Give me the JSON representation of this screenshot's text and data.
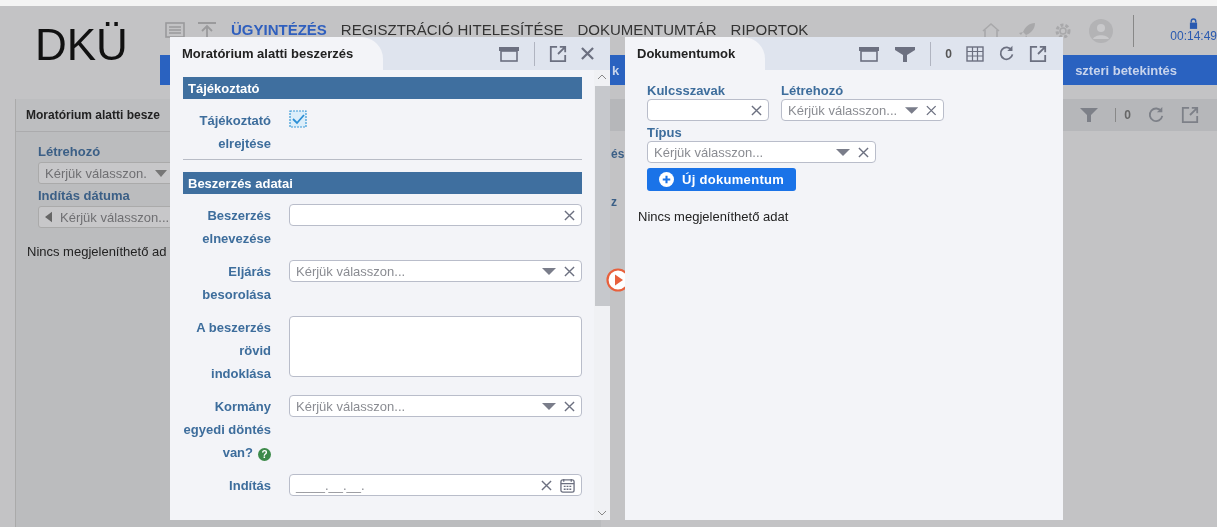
{
  "header": {
    "logo": "DKÜ",
    "nav": [
      {
        "label": "ÜGYINTÉZÉS",
        "selected": true
      },
      {
        "label": "REGISZTRÁCIÓ HITELESÍTÉSE",
        "selected": false
      },
      {
        "label": "DOKUMENTUMTÁR",
        "selected": false
      },
      {
        "label": "RIPORTOK",
        "selected": false
      }
    ],
    "clock": "00:14:49"
  },
  "blue_bar": {
    "left_fragment": "k",
    "right_fragment": "szteri betekintés"
  },
  "background_panel": {
    "title": "Moratórium alatti besze",
    "fields": [
      {
        "label": "Létrehozó",
        "placeholder": "Kérjük válasszon."
      },
      {
        "label": "Indítás dátuma",
        "placeholder": "Kérjük válasszon..."
      }
    ],
    "empty": "Nincs megjeleníthető ad"
  },
  "background_panel_2": {
    "fragments": [
      "és",
      "z"
    ],
    "count": "0"
  },
  "procurement_window": {
    "title": "Moratórium alatti beszerzés",
    "sections": [
      {
        "title": "Tájékoztató",
        "fields": [
          {
            "kind": "checkbox",
            "label": "Tájékoztató elrejtése",
            "checked": true
          }
        ]
      },
      {
        "title": "Beszerzés adatai",
        "fields": [
          {
            "kind": "text",
            "label": "Beszerzés elnevezése"
          },
          {
            "kind": "select",
            "label": "Eljárás besorolása",
            "placeholder": "Kérjük válasszon..."
          },
          {
            "kind": "textarea",
            "label": "A beszerzés rövid indoklása"
          },
          {
            "kind": "select",
            "label": "Kormány egyedi döntés van?",
            "placeholder": "Kérjük válasszon...",
            "help": "?"
          },
          {
            "kind": "date",
            "label": "Indítás",
            "placeholder": "____.__.__."
          }
        ]
      }
    ]
  },
  "documents_window": {
    "title": "Dokumentumok",
    "count": "0",
    "filters": [
      {
        "kind": "text",
        "label": "Kulcsszavak"
      },
      {
        "kind": "select",
        "label": "Létrehozó",
        "placeholder": "Kérjük válasszon..."
      },
      {
        "kind": "select",
        "label": "Típus",
        "placeholder": "Kérjük válasszon..."
      }
    ],
    "add_button": "Új dokumentum",
    "empty": "Nincs megjeleníthető adat"
  }
}
